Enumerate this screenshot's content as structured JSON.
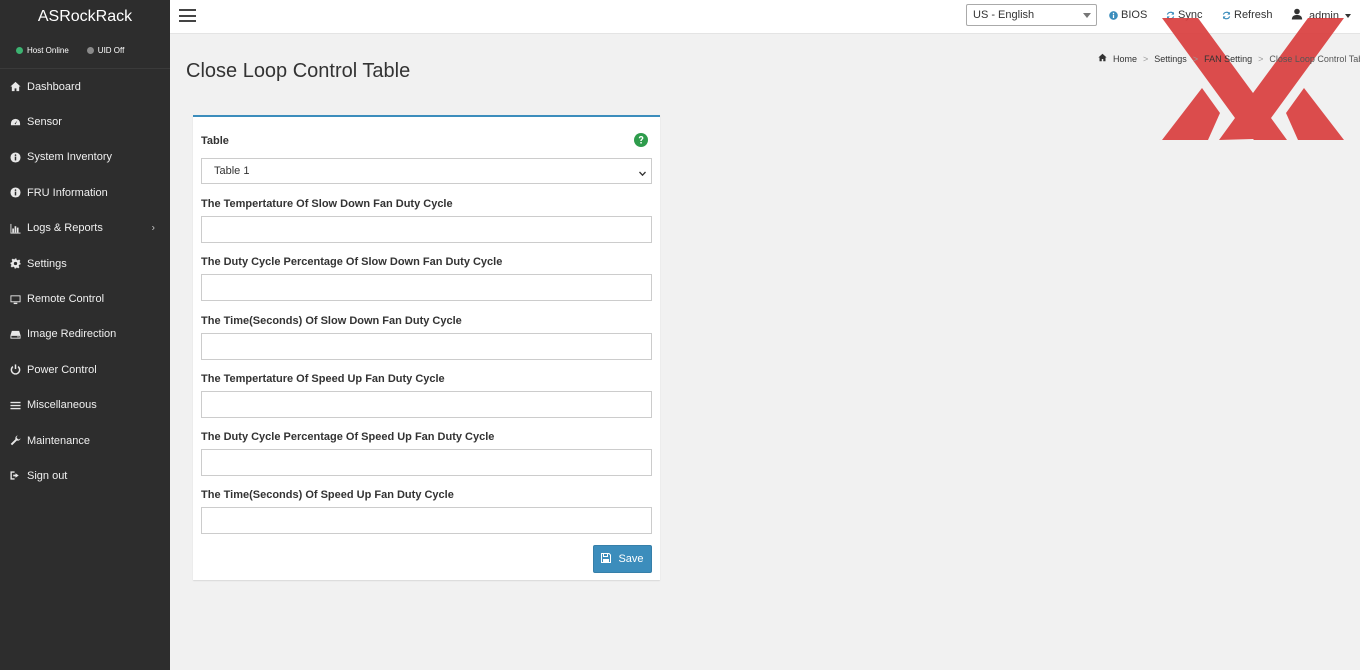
{
  "app": {
    "brand": "ASRockRack"
  },
  "status": {
    "host": {
      "label": "Host Online",
      "color": "#3cb371"
    },
    "uid": {
      "label": "UID Off",
      "color": "#8a8a8a"
    }
  },
  "sidebar": {
    "items": [
      {
        "label": "Dashboard",
        "icon": "home-icon"
      },
      {
        "label": "Sensor",
        "icon": "gauge-icon"
      },
      {
        "label": "System Inventory",
        "icon": "info-icon"
      },
      {
        "label": "FRU Information",
        "icon": "info-icon"
      },
      {
        "label": "Logs & Reports",
        "icon": "bar-chart-icon"
      },
      {
        "label": "Settings",
        "icon": "gear-icon"
      },
      {
        "label": "Remote Control",
        "icon": "monitor-icon"
      },
      {
        "label": "Image Redirection",
        "icon": "disk-icon"
      },
      {
        "label": "Power Control",
        "icon": "power-icon"
      },
      {
        "label": "Miscellaneous",
        "icon": "list-icon"
      },
      {
        "label": "Maintenance",
        "icon": "wrench-icon"
      },
      {
        "label": "Sign out",
        "icon": "sign-out-icon"
      }
    ]
  },
  "topbar": {
    "language": "US - English",
    "bios": "BIOS",
    "sync": "Sync",
    "refresh": "Refresh",
    "user": "admin"
  },
  "breadcrumb": {
    "home": "Home",
    "settings": "Settings",
    "fan": "FAN Setting",
    "current": "Close Loop Control Table"
  },
  "page": {
    "title": "Close Loop Control Table"
  },
  "form": {
    "table_label": "Table",
    "table_value": "Table 1",
    "fields": [
      {
        "label": "The Tempertature Of Slow Down Fan Duty Cycle",
        "value": ""
      },
      {
        "label": "The Duty Cycle Percentage Of Slow Down Fan Duty Cycle",
        "value": ""
      },
      {
        "label": "The Time(Seconds) Of Slow Down Fan Duty Cycle",
        "value": ""
      },
      {
        "label": "The Tempertature Of Speed Up Fan Duty Cycle",
        "value": ""
      },
      {
        "label": "The Duty Cycle Percentage Of Speed Up Fan Duty Cycle",
        "value": ""
      },
      {
        "label": "The Time(Seconds) Of Speed Up Fan Duty Cycle",
        "value": ""
      }
    ],
    "save_label": "Save"
  },
  "colors": {
    "sidebar_bg": "#2d2d2d",
    "accent": "#3c8dbc",
    "help_green": "#2e9c4c",
    "logo_red": "#d83a3a"
  }
}
